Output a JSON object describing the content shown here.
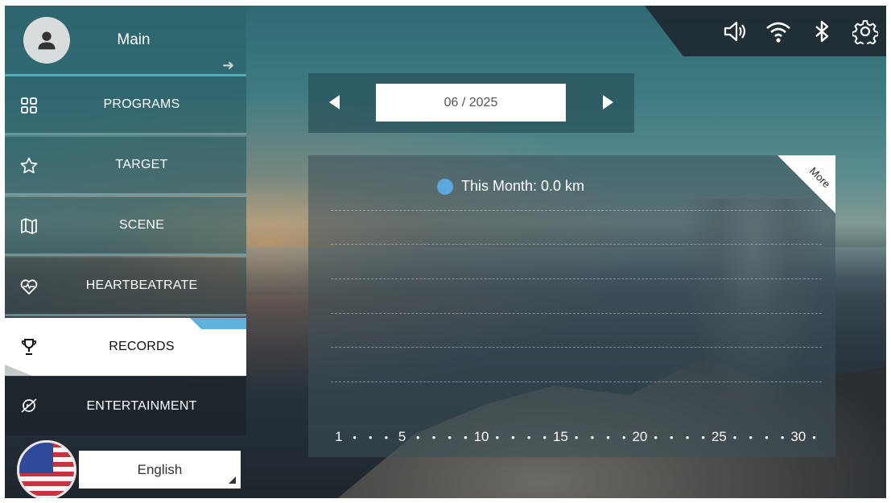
{
  "header": {
    "main_label": "Main"
  },
  "status_icons": [
    "speaker-icon",
    "wifi-icon",
    "bluetooth-icon",
    "gear-icon"
  ],
  "sidebar": {
    "items": [
      {
        "label": "PROGRAMS",
        "icon": "grid-icon"
      },
      {
        "label": "TARGET",
        "icon": "star-icon"
      },
      {
        "label": "SCENE",
        "icon": "map-icon"
      },
      {
        "label": "HEARTBEATRATE",
        "icon": "heartbeat-icon"
      },
      {
        "label": "RECORDS",
        "icon": "trophy-icon",
        "selected": true
      },
      {
        "label": "ENTERTAINMENT",
        "icon": "entertainment-icon"
      }
    ]
  },
  "language": {
    "selected": "English",
    "flag": "us-flag"
  },
  "month_selector": {
    "value": "06 / 2025"
  },
  "chart": {
    "more_label": "More",
    "legend": "This Month: 0.0 km",
    "legend_color": "#5ba8de"
  },
  "chart_data": {
    "type": "bar",
    "x_tick_labels": [
      "1",
      "5",
      "10",
      "15",
      "20",
      "25",
      "30"
    ],
    "x": [
      1,
      2,
      3,
      4,
      5,
      6,
      7,
      8,
      9,
      10,
      11,
      12,
      13,
      14,
      15,
      16,
      17,
      18,
      19,
      20,
      21,
      22,
      23,
      24,
      25,
      26,
      27,
      28,
      29,
      30
    ],
    "series": [
      {
        "name": "This Month: 0.0 km",
        "values": [
          0,
          0,
          0,
          0,
          0,
          0,
          0,
          0,
          0,
          0,
          0,
          0,
          0,
          0,
          0,
          0,
          0,
          0,
          0,
          0,
          0,
          0,
          0,
          0,
          0,
          0,
          0,
          0,
          0,
          0
        ]
      }
    ],
    "grid": true,
    "legend_position": "top-center"
  }
}
